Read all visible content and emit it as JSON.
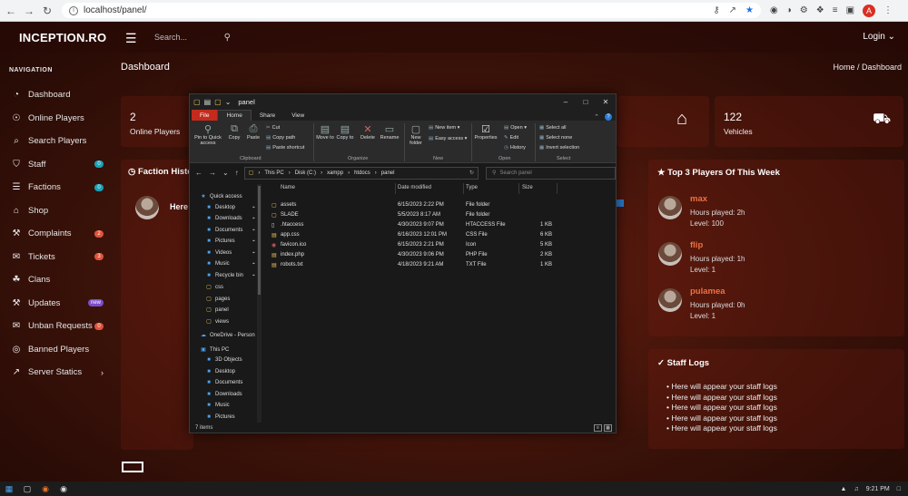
{
  "browser": {
    "url": "localhost/panel/",
    "profile_initial": "A"
  },
  "site": {
    "brand": "INCEPTION.RO",
    "search_placeholder": "Search...",
    "login": "Login ⌄",
    "nav_heading": "NAVIGATION",
    "nav": [
      {
        "label": "Dashboard",
        "icon": "dashboard-icon",
        "glyph": "◔"
      },
      {
        "label": "Online Players",
        "icon": "gamepad-icon",
        "glyph": "☉"
      },
      {
        "label": "Search Players",
        "icon": "search-icon",
        "glyph": "⌕"
      },
      {
        "label": "Staff",
        "icon": "shield-icon",
        "glyph": "⛉",
        "badge": "0",
        "badge_color": "teal"
      },
      {
        "label": "Factions",
        "icon": "factions-icon",
        "glyph": "☰",
        "badge": "0",
        "badge_color": "teal"
      },
      {
        "label": "Shop",
        "icon": "shop-icon",
        "glyph": "⌂"
      },
      {
        "label": "Complaints",
        "icon": "hammer-icon",
        "glyph": "⚒",
        "badge": "2",
        "badge_color": "orange"
      },
      {
        "label": "Tickets",
        "icon": "ticket-icon",
        "glyph": "✉",
        "badge": "3",
        "badge_color": "orange"
      },
      {
        "label": "Clans",
        "icon": "clans-icon",
        "glyph": "☘"
      },
      {
        "label": "Updates",
        "icon": "wrench-icon",
        "glyph": "⚒",
        "badge": "new",
        "badge_color": "purple"
      },
      {
        "label": "Unban Requests",
        "icon": "unban-icon",
        "glyph": "✉",
        "badge": "0",
        "badge_color": "orange"
      },
      {
        "label": "Banned Players",
        "icon": "ban-icon",
        "glyph": "◎"
      },
      {
        "label": "Server Statics",
        "icon": "chart-icon",
        "glyph": "↗",
        "chevron": "›"
      }
    ],
    "page_title": "Dashboard",
    "breadcrumb": "Home  /  Dashboard",
    "stats": [
      {
        "value": "2",
        "label": "Online Players"
      },
      {
        "value": "122",
        "label": "Vehicles"
      }
    ],
    "faction_card_title": "Faction Histo",
    "faction_text": "Here",
    "top_players_title": "Top 3 Players Of This Week",
    "top_players": [
      {
        "name": "max",
        "hours": "Hours played: 2h",
        "level": "Level: 100"
      },
      {
        "name": "flip",
        "hours": "Hours played: 1h",
        "level": "Level: 1"
      },
      {
        "name": "pulamea",
        "hours": "Hours played: 0h",
        "level": "Level: 1"
      }
    ],
    "staff_logs_title": "Staff Logs",
    "staff_logs": [
      "Here will appear your staff logs",
      "Here will appear your staff logs",
      "Here will appear your staff logs",
      "Here will appear your staff logs",
      "Here will appear your staff logs"
    ]
  },
  "explorer": {
    "title": "panel",
    "tabs": [
      "File",
      "Home",
      "Share",
      "View"
    ],
    "ribbon": {
      "pin": "Pin to Quick access",
      "copy": "Copy",
      "paste": "Paste",
      "cut": "Cut",
      "copy_path": "Copy path",
      "paste_shortcut": "Paste shortcut",
      "clipboard": "Clipboard",
      "move_to": "Move to",
      "copy_to": "Copy to",
      "delete": "Delete",
      "rename": "Rename",
      "organize": "Organize",
      "new_folder": "New folder",
      "new_item": "New item",
      "easy_access": "Easy access",
      "new": "New",
      "properties": "Properties",
      "open_btn": "Open",
      "edit": "Edit",
      "history": "History",
      "open_group": "Open",
      "select_all": "Select all",
      "select_none": "Select none",
      "invert_selection": "Invert selection",
      "select_group": "Select"
    },
    "path": [
      "This PC",
      "Disk (C:)",
      "xampp",
      "htdocs",
      "panel"
    ],
    "search_placeholder": "Search panel",
    "nav_pane": [
      {
        "label": "Quick access",
        "kind": "star"
      },
      {
        "label": "Desktop",
        "kind": "blue",
        "pin": true
      },
      {
        "label": "Downloads",
        "kind": "blue",
        "pin": true
      },
      {
        "label": "Documents",
        "kind": "blue",
        "pin": true
      },
      {
        "label": "Pictures",
        "kind": "blue",
        "pin": true
      },
      {
        "label": "Videos",
        "kind": "blue",
        "pin": true
      },
      {
        "label": "Music",
        "kind": "blue",
        "pin": true
      },
      {
        "label": "Recycle bin",
        "kind": "blue",
        "pin": true
      },
      {
        "label": "css",
        "kind": "folder"
      },
      {
        "label": "pages",
        "kind": "folder"
      },
      {
        "label": "panel",
        "kind": "folder"
      },
      {
        "label": "views",
        "kind": "folder"
      },
      {
        "label": "OneDrive - Person",
        "kind": "cloud"
      },
      {
        "label": "This PC",
        "kind": "pc"
      },
      {
        "label": "3D Objects",
        "kind": "blue"
      },
      {
        "label": "Desktop",
        "kind": "blue"
      },
      {
        "label": "Documents",
        "kind": "blue"
      },
      {
        "label": "Downloads",
        "kind": "blue"
      },
      {
        "label": "Music",
        "kind": "blue"
      },
      {
        "label": "Pictures",
        "kind": "blue"
      }
    ],
    "columns": [
      "Name",
      "Date modified",
      "Type",
      "Size"
    ],
    "files": [
      {
        "name": "assets",
        "date": "6/15/2023 2:22 PM",
        "type": "File folder",
        "size": "",
        "kind": "folder"
      },
      {
        "name": "SLADE",
        "date": "5/5/2023 8:17 AM",
        "type": "File folder",
        "size": "",
        "kind": "folder"
      },
      {
        "name": ".htaccess",
        "date": "4/30/2023 9:07 PM",
        "type": "HTACCESS File",
        "size": "1 KB",
        "kind": "file"
      },
      {
        "name": "app.css",
        "date": "6/16/2023 12:01 PM",
        "type": "CSS File",
        "size": "6 KB",
        "kind": "code"
      },
      {
        "name": "favicon.ico",
        "date": "6/15/2023 2:21 PM",
        "type": "Icon",
        "size": "5 KB",
        "kind": "ico"
      },
      {
        "name": "index.php",
        "date": "4/30/2023 9:06 PM",
        "type": "PHP File",
        "size": "2 KB",
        "kind": "code"
      },
      {
        "name": "robots.txt",
        "date": "4/18/2023 9:21 AM",
        "type": "TXT File",
        "size": "1 KB",
        "kind": "code"
      }
    ],
    "status": "7 items"
  },
  "taskbar": {
    "time": "9:21 PM"
  }
}
